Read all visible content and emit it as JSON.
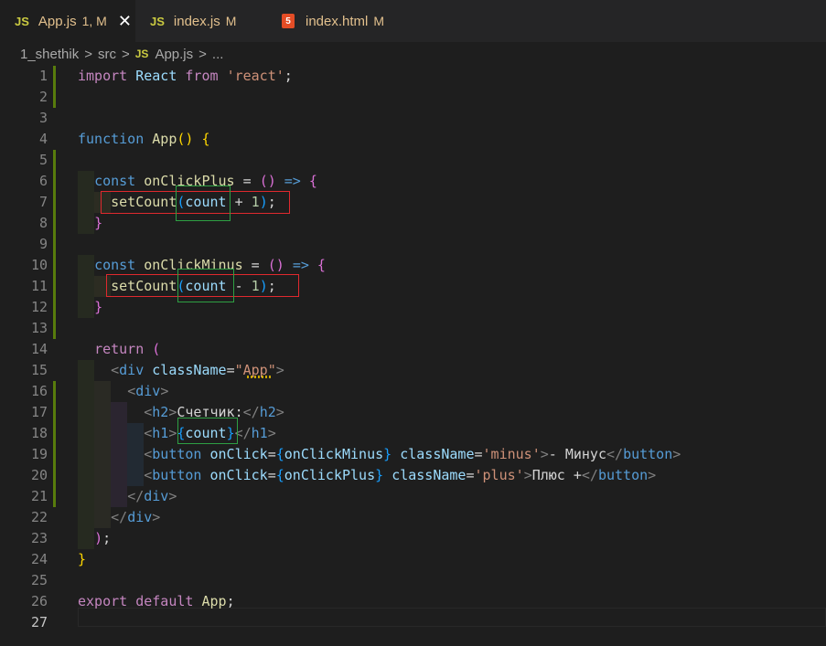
{
  "tabs": [
    {
      "icon": "JS",
      "name": "App.js",
      "badge": "1, M",
      "close": "✕",
      "active": true
    },
    {
      "icon": "JS",
      "name": "index.js",
      "badge": "M",
      "active": false
    },
    {
      "icon": "5",
      "name": "index.html",
      "badge": "M",
      "active": false
    }
  ],
  "breadcrumb": {
    "folder": "1_shethik",
    "sep1": ">",
    "subfolder": "src",
    "sep2": ">",
    "file_icon": "JS",
    "file": "App.js",
    "sep3": ">",
    "more": "..."
  },
  "line_numbers": [
    "1",
    "2",
    "3",
    "4",
    "5",
    "6",
    "7",
    "8",
    "9",
    "10",
    "11",
    "12",
    "13",
    "14",
    "15",
    "16",
    "17",
    "18",
    "19",
    "20",
    "21",
    "22",
    "23",
    "24",
    "25",
    "26",
    "27"
  ],
  "code": {
    "l1": {
      "import": "import",
      "React": "React",
      "from": "from",
      "mod": "'react'",
      "semi": ";"
    },
    "l4": {
      "function": "function",
      "name": "App",
      "parens": "()",
      "brace": "{"
    },
    "l6": {
      "const": "const",
      "name": "onClickPlus",
      "eq": "=",
      "parens": "()",
      "arrow": "=>",
      "brace": "{"
    },
    "l7": {
      "call": "setCount",
      "open": "(",
      "arg": "count",
      "rest": "+ ",
      "num": "1",
      "close": ")",
      "semi": ";"
    },
    "l8": {
      "brace": "}"
    },
    "l10": {
      "const": "const",
      "name": "onClickMinus",
      "eq": "=",
      "parens": "()",
      "arrow": "=>",
      "brace": "{"
    },
    "l11": {
      "call": "setCount",
      "open": "(",
      "arg": "count",
      "rest": "- ",
      "num": "1",
      "close": ")",
      "semi": ";"
    },
    "l12": {
      "brace": "}"
    },
    "l14": {
      "return": "return",
      "paren": "("
    },
    "l15": {
      "lt": "<",
      "tag": "div",
      "attr": "className",
      "eq": "=",
      "q1": "\"",
      "val": "App",
      "q2": "\"",
      "gt": ">"
    },
    "l16": {
      "lt": "<",
      "tag": "div",
      "gt": ">"
    },
    "l17": {
      "lt": "<",
      "tag": "h2",
      "gt": ">",
      "text": "Счетчик:",
      "lt2": "</",
      "tag2": "h2",
      "gt2": ">"
    },
    "l18": {
      "lt": "<",
      "tag": "h1",
      "gt": ">",
      "ob": "{",
      "expr": "count",
      "cb": "}",
      "lt2": "</",
      "tag2": "h1",
      "gt2": ">"
    },
    "l19": {
      "lt": "<",
      "tag": "button",
      "attr1": "onClick",
      "eq1": "=",
      "ob": "{",
      "handler": "onClickMinus",
      "cb": "}",
      "attr2": "className",
      "eq2": "=",
      "val": "'minus'",
      "gt": ">",
      "text": "- Минус",
      "lt2": "</",
      "tag2": "button",
      "gt2": ">"
    },
    "l20": {
      "lt": "<",
      "tag": "button",
      "attr1": "onClick",
      "eq1": "=",
      "ob": "{",
      "handler": "onClickPlus",
      "cb": "}",
      "attr2": "className",
      "eq2": "=",
      "val": "'plus'",
      "gt": ">",
      "text": "Плюс +",
      "lt2": "</",
      "tag2": "button",
      "gt2": ">"
    },
    "l21": {
      "lt": "</",
      "tag": "div",
      "gt": ">"
    },
    "l22": {
      "lt": "</",
      "tag": "div",
      "gt": ">"
    },
    "l23": {
      "paren": ")",
      "semi": ";"
    },
    "l24": {
      "brace": "}"
    },
    "l26": {
      "export": "export",
      "default": "default",
      "name": "App",
      "semi": ";"
    }
  },
  "colors": {
    "editor_bg": "#1e1e1e",
    "tab_bar_bg": "#252526",
    "keyword": "#569cd6",
    "control": "#c586c0",
    "function": "#dcdcaa",
    "variable": "#9cdcfe",
    "string": "#ce9178",
    "number": "#b5cea8",
    "modified": "#e2c08d",
    "git_added": "#587c0c",
    "highlight_red": "#e0292e",
    "highlight_green": "#2ea043"
  }
}
